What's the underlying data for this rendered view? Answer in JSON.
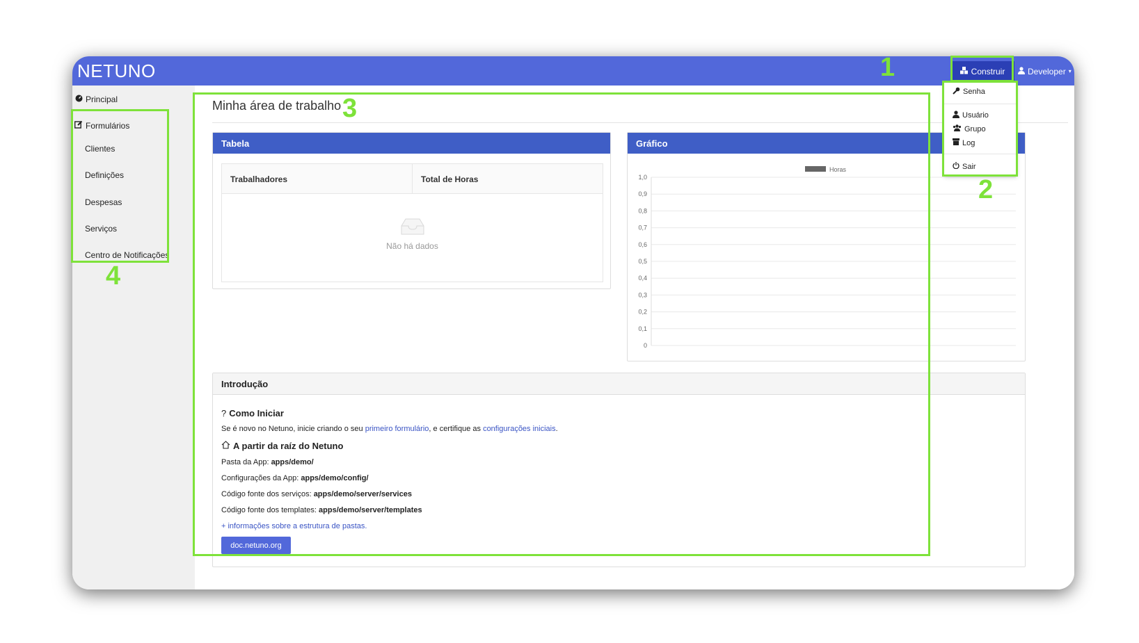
{
  "app": {
    "logo": "NETUNO"
  },
  "topbar": {
    "construir_label": "Construir",
    "developer_label": "Developer"
  },
  "sidebar": {
    "principal": "Principal",
    "formularios": "Formulários",
    "items": [
      "Clientes",
      "Definições",
      "Despesas",
      "Serviços",
      "Centro de Notificações"
    ]
  },
  "main": {
    "title": "Minha área de trabalho",
    "tabela": {
      "title": "Tabela",
      "columns": [
        "Trabalhadores",
        "Total de Horas"
      ],
      "empty_text": "Não há dados"
    },
    "grafico": {
      "title": "Gráfico"
    },
    "intro": {
      "title": "Introdução",
      "como_iniciar": "Como Iniciar",
      "line1_pre": "Se é novo no Netuno, inicie criando o seu ",
      "line1_link1": "primeiro formulário",
      "line1_mid": ", e certifique as ",
      "line1_link2": "configurações iniciais",
      "line1_post": ".",
      "raiz_title": "A partir da raíz do Netuno",
      "paths": [
        {
          "label": "Pasta da App: ",
          "value": "apps/demo/"
        },
        {
          "label": "Configurações da App: ",
          "value": "apps/demo/config/"
        },
        {
          "label": "Código fonte dos serviços: ",
          "value": "apps/demo/server/services"
        },
        {
          "label": "Código fonte dos templates: ",
          "value": "apps/demo/server/templates"
        }
      ],
      "more_link": "+ informações sobre a estrutura de pastas.",
      "doc_button": "doc.netuno.org"
    }
  },
  "dropdown": {
    "items": [
      "Senha",
      "Usuário",
      "Grupo",
      "Log",
      "Sair"
    ]
  },
  "annotations": {
    "labels": [
      "1",
      "2",
      "3",
      "4"
    ],
    "color": "#7ee23a"
  },
  "chart_data": {
    "type": "bar",
    "categories": [],
    "series": [
      {
        "name": "Horas",
        "values": []
      }
    ],
    "y_ticks": [
      "1,0",
      "0,9",
      "0,8",
      "0,7",
      "0,6",
      "0,5",
      "0,4",
      "0,3",
      "0,2",
      "0,1",
      "0"
    ],
    "ylim": [
      0,
      1
    ],
    "grid": true,
    "legend": "top-center",
    "series_color": "#666666"
  }
}
